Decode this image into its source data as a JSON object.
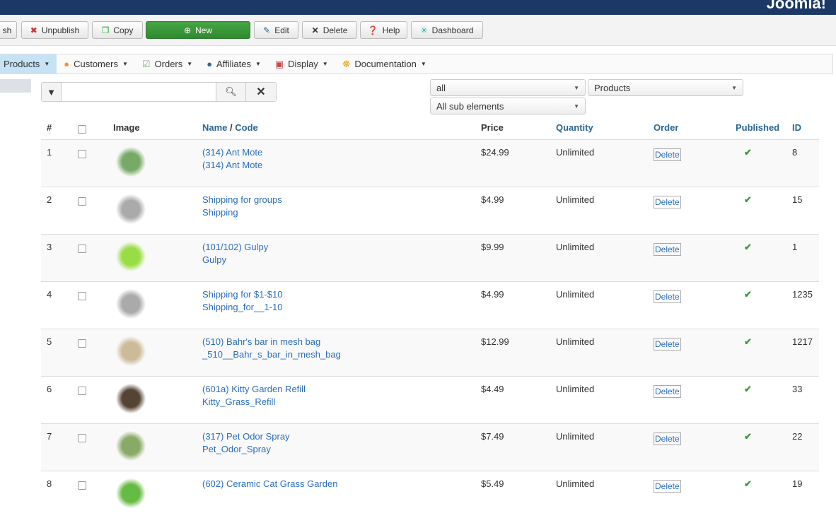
{
  "brand": "Joomla!",
  "toolbar": {
    "publish": "sh",
    "unpublish": "Unpublish",
    "copy": "Copy",
    "new": "New",
    "edit": "Edit",
    "delete": "Delete",
    "help": "Help",
    "dashboard": "Dashboard"
  },
  "menu": [
    {
      "label": "Products",
      "icon": "products-icon"
    },
    {
      "label": "Customers",
      "icon": "customers-icon"
    },
    {
      "label": "Orders",
      "icon": "orders-icon"
    },
    {
      "label": "Affiliates",
      "icon": "affiliates-icon"
    },
    {
      "label": "Display",
      "icon": "display-icon"
    },
    {
      "label": "Documentation",
      "icon": "documentation-icon"
    }
  ],
  "search": {
    "value": ""
  },
  "filters": {
    "status": "all",
    "type": "Products",
    "sub": "All sub elements"
  },
  "columns": {
    "num": "#",
    "image": "Image",
    "name": "Name",
    "sep": " / ",
    "code": "Code",
    "price": "Price",
    "quantity": "Quantity",
    "order": "Order",
    "published": "Published",
    "id": "ID"
  },
  "rows": [
    {
      "n": "1",
      "name": "(314) Ant Mote",
      "code": "(314) Ant Mote",
      "price": "$24.99",
      "qty": "Unlimited",
      "order": "Delete",
      "id": "8",
      "img": "#7a6"
    },
    {
      "n": "2",
      "name": "Shipping for groups",
      "code": "Shipping",
      "price": "$4.99",
      "qty": "Unlimited",
      "order": "Delete",
      "id": "15",
      "img": "#aaa"
    },
    {
      "n": "3",
      "name": "(101/102) Gulpy",
      "code": "Gulpy",
      "price": "$9.99",
      "qty": "Unlimited",
      "order": "Delete",
      "id": "1",
      "img": "#9d4"
    },
    {
      "n": "4",
      "name": "Shipping for $1-$10",
      "code": "Shipping_for__1-10",
      "price": "$4.99",
      "qty": "Unlimited",
      "order": "Delete",
      "id": "1235",
      "img": "#aaa"
    },
    {
      "n": "5",
      "name": "(510) Bahr's bar in mesh bag",
      "code": "_510__Bahr_s_bar_in_mesh_bag",
      "price": "$12.99",
      "qty": "Unlimited",
      "order": "Delete",
      "id": "1217",
      "img": "#cb9"
    },
    {
      "n": "6",
      "name": "(601a) Kitty Garden Refill",
      "code": "Kitty_Grass_Refill",
      "price": "$4.49",
      "qty": "Unlimited",
      "order": "Delete",
      "id": "33",
      "img": "#543"
    },
    {
      "n": "7",
      "name": "(317) Pet Odor Spray",
      "code": "Pet_Odor_Spray",
      "price": "$7.49",
      "qty": "Unlimited",
      "order": "Delete",
      "id": "22",
      "img": "#8a6"
    },
    {
      "n": "8",
      "name": "(602) Ceramic Cat Grass Garden",
      "code": "",
      "price": "$5.49",
      "qty": "Unlimited",
      "order": "Delete",
      "id": "19",
      "img": "#6b4"
    }
  ]
}
